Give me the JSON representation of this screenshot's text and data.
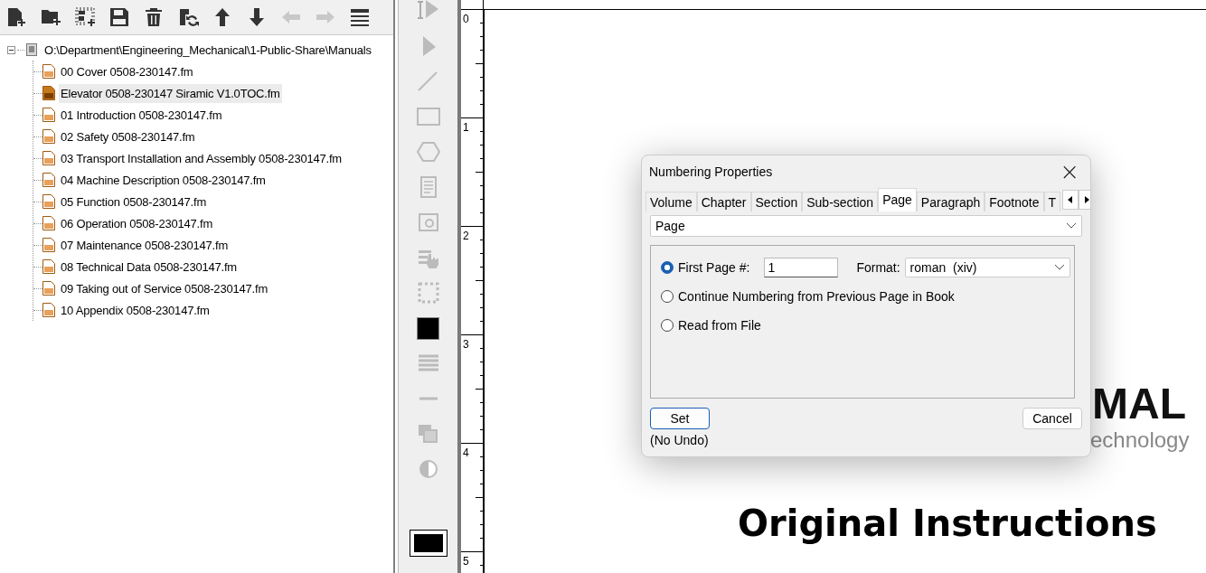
{
  "toolbar": [
    {
      "kind": "add-file",
      "disabled": false
    },
    {
      "kind": "add-folder",
      "disabled": false
    },
    {
      "kind": "add-selection",
      "disabled": false
    },
    {
      "kind": "save",
      "disabled": false
    },
    {
      "kind": "delete",
      "disabled": false
    },
    {
      "kind": "refresh",
      "disabled": false
    },
    {
      "kind": "up",
      "disabled": false
    },
    {
      "kind": "down",
      "disabled": false
    },
    {
      "kind": "left",
      "disabled": true
    },
    {
      "kind": "right",
      "disabled": true
    },
    {
      "kind": "menu",
      "disabled": false
    }
  ],
  "tree": {
    "root": "O:\\Department\\Engineering_Mechanical\\1-Public-Share\\Manuals",
    "expanded": true,
    "children": [
      {
        "label": "00 Cover 0508-230147.fm",
        "selected": false
      },
      {
        "label": "Elevator 0508-230147 Siramic V1.0TOC.fm",
        "selected": true
      },
      {
        "label": "01 Introduction 0508-230147.fm",
        "selected": false
      },
      {
        "label": "02 Safety 0508-230147.fm",
        "selected": false
      },
      {
        "label": "03 Transport Installation and Assembly 0508-230147.fm",
        "selected": false
      },
      {
        "label": "04 Machine Description 0508-230147.fm",
        "selected": false
      },
      {
        "label": "05 Function 0508-230147.fm",
        "selected": false
      },
      {
        "label": "06 Operation 0508-230147.fm",
        "selected": false
      },
      {
        "label": "07 Maintenance 0508-230147.fm",
        "selected": false
      },
      {
        "label": "08 Technical Data 0508-230147.fm",
        "selected": false
      },
      {
        "label": "09 Taking out of Service 0508-230147.fm",
        "selected": false
      },
      {
        "label": "10 Appendix 0508-230147.fm",
        "selected": false
      }
    ]
  },
  "ruler": [
    "0",
    "1",
    "2",
    "3",
    "4",
    "5"
  ],
  "page": {
    "logo_text": "MAL",
    "logo_subtext": "echnology",
    "heading": "Original Instructions"
  },
  "dialog": {
    "title": "Numbering Properties",
    "close": "×",
    "tabs": [
      {
        "label": "Volume",
        "selected": false
      },
      {
        "label": "Chapter",
        "selected": false
      },
      {
        "label": "Section",
        "selected": false
      },
      {
        "label": "Sub-section",
        "selected": false
      },
      {
        "label": "Page",
        "selected": true
      },
      {
        "label": "Paragraph",
        "selected": false
      },
      {
        "label": "Footnote",
        "selected": false
      },
      {
        "label": "T",
        "selected": false
      }
    ],
    "type_select": "Page",
    "options": [
      {
        "label": "First Page #:",
        "selected": true
      },
      {
        "label": "Continue Numbering from Previous Page in Book",
        "selected": false
      },
      {
        "label": "Read from File",
        "selected": false
      }
    ],
    "first_page_value": "1",
    "format_label": "Format:",
    "format_value": "roman  (xiv)",
    "set_button": "Set",
    "cancel_button": "Cancel",
    "note": "(No Undo)"
  }
}
